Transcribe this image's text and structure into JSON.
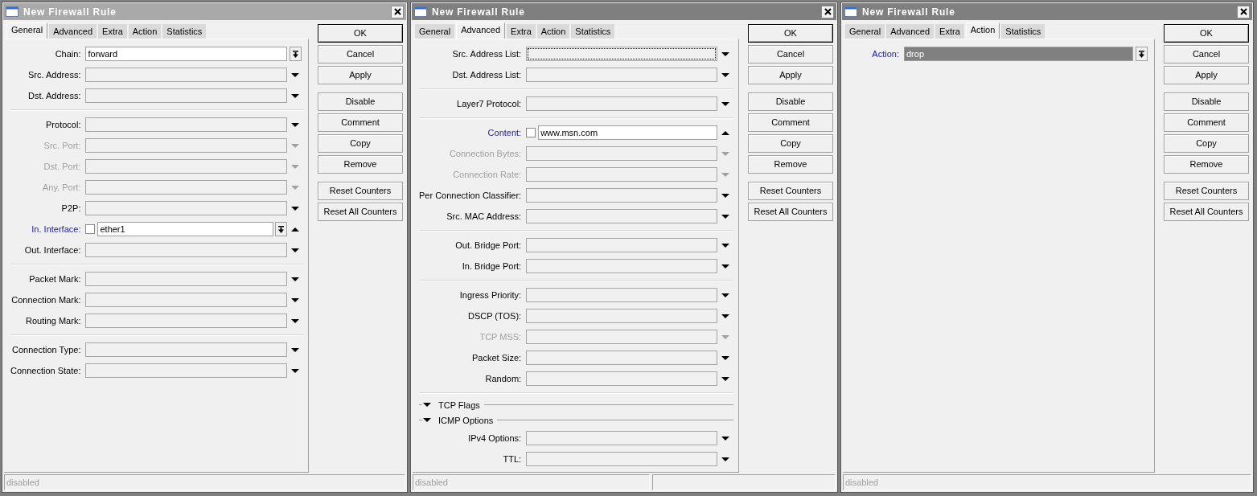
{
  "windows": [
    {
      "title": "New Firewall Rule",
      "active": false,
      "tabs": [
        {
          "label": "General",
          "selected": true
        },
        {
          "label": "Advanced",
          "selected": false
        },
        {
          "label": "Extra",
          "selected": false
        },
        {
          "label": "Action",
          "selected": false
        },
        {
          "label": "Statistics",
          "selected": false
        }
      ],
      "rows": [
        {
          "kind": "fixed",
          "label": "Chain:",
          "emphasized": false,
          "disabled": false,
          "focused": false,
          "value": "forward",
          "dropdown": true,
          "value_selected": false
        },
        {
          "kind": "field",
          "label": "Src. Address:",
          "emphasized": false,
          "disabled": false,
          "focused": false,
          "expanded": false
        },
        {
          "kind": "field",
          "label": "Dst. Address:",
          "emphasized": false,
          "disabled": false,
          "focused": false,
          "expanded": false
        },
        {
          "kind": "separator"
        },
        {
          "kind": "field",
          "label": "Protocol:",
          "emphasized": false,
          "disabled": false,
          "focused": false,
          "expanded": false
        },
        {
          "kind": "field",
          "label": "Src. Port:",
          "emphasized": false,
          "disabled": true,
          "focused": false,
          "expanded": false
        },
        {
          "kind": "field",
          "label": "Dst. Port:",
          "emphasized": false,
          "disabled": true,
          "focused": false,
          "expanded": false
        },
        {
          "kind": "field",
          "label": "Any. Port:",
          "emphasized": false,
          "disabled": true,
          "focused": false,
          "expanded": false
        },
        {
          "kind": "field",
          "label": "P2P:",
          "emphasized": false,
          "disabled": false,
          "focused": false,
          "expanded": false
        },
        {
          "kind": "field",
          "label": "In. Interface:",
          "emphasized": true,
          "disabled": false,
          "focused": false,
          "expanded": true,
          "checked": false,
          "value": "ether1",
          "dropdown": true,
          "value_selected": false
        },
        {
          "kind": "field",
          "label": "Out. Interface:",
          "emphasized": false,
          "disabled": false,
          "focused": false,
          "expanded": false
        },
        {
          "kind": "separator"
        },
        {
          "kind": "field",
          "label": "Packet Mark:",
          "emphasized": false,
          "disabled": false,
          "focused": false,
          "expanded": false
        },
        {
          "kind": "field",
          "label": "Connection Mark:",
          "emphasized": false,
          "disabled": false,
          "focused": false,
          "expanded": false
        },
        {
          "kind": "field",
          "label": "Routing Mark:",
          "emphasized": false,
          "disabled": false,
          "focused": false,
          "expanded": false
        },
        {
          "kind": "separator"
        },
        {
          "kind": "field",
          "label": "Connection Type:",
          "emphasized": false,
          "disabled": false,
          "focused": false,
          "expanded": false
        },
        {
          "kind": "field",
          "label": "Connection State:",
          "emphasized": false,
          "disabled": false,
          "focused": false,
          "expanded": false
        }
      ],
      "button_groups": [
        [
          {
            "label": "OK",
            "default": true
          },
          {
            "label": "Cancel",
            "default": false
          },
          {
            "label": "Apply",
            "default": false
          }
        ],
        [
          {
            "label": "Disable",
            "default": false
          },
          {
            "label": "Comment",
            "default": false
          },
          {
            "label": "Copy",
            "default": false
          },
          {
            "label": "Remove",
            "default": false
          }
        ],
        [
          {
            "label": "Reset Counters",
            "default": false
          },
          {
            "label": "Reset All Counters",
            "default": false
          }
        ]
      ],
      "status_bar": {
        "text": "disabled",
        "extra_panel": false
      }
    },
    {
      "title": "New Firewall Rule",
      "active": true,
      "tabs": [
        {
          "label": "General",
          "selected": false
        },
        {
          "label": "Advanced",
          "selected": true
        },
        {
          "label": "Extra",
          "selected": false
        },
        {
          "label": "Action",
          "selected": false
        },
        {
          "label": "Statistics",
          "selected": false
        }
      ],
      "rows": [
        {
          "kind": "field",
          "label": "Src. Address List:",
          "emphasized": false,
          "disabled": false,
          "focused": true,
          "expanded": false
        },
        {
          "kind": "field",
          "label": "Dst. Address List:",
          "emphasized": false,
          "disabled": false,
          "focused": false,
          "expanded": false
        },
        {
          "kind": "separator"
        },
        {
          "kind": "field",
          "label": "Layer7 Protocol:",
          "emphasized": false,
          "disabled": false,
          "focused": false,
          "expanded": false
        },
        {
          "kind": "separator"
        },
        {
          "kind": "field",
          "label": "Content:",
          "emphasized": true,
          "disabled": false,
          "focused": false,
          "expanded": true,
          "checked": false,
          "value": "www.msn.com",
          "dropdown": false,
          "value_selected": false
        },
        {
          "kind": "field",
          "label": "Connection Bytes:",
          "emphasized": false,
          "disabled": true,
          "focused": false,
          "expanded": false
        },
        {
          "kind": "field",
          "label": "Connection Rate:",
          "emphasized": false,
          "disabled": true,
          "focused": false,
          "expanded": false
        },
        {
          "kind": "field",
          "label": "Per Connection Classifier:",
          "emphasized": false,
          "disabled": false,
          "focused": false,
          "expanded": false
        },
        {
          "kind": "field",
          "label": "Src. MAC Address:",
          "emphasized": false,
          "disabled": false,
          "focused": false,
          "expanded": false
        },
        {
          "kind": "separator"
        },
        {
          "kind": "field",
          "label": "Out. Bridge Port:",
          "emphasized": false,
          "disabled": false,
          "focused": false,
          "expanded": false
        },
        {
          "kind": "field",
          "label": "In. Bridge Port:",
          "emphasized": false,
          "disabled": false,
          "focused": false,
          "expanded": false
        },
        {
          "kind": "separator"
        },
        {
          "kind": "field",
          "label": "Ingress Priority:",
          "emphasized": false,
          "disabled": false,
          "focused": false,
          "expanded": false
        },
        {
          "kind": "field",
          "label": "DSCP (TOS):",
          "emphasized": false,
          "disabled": false,
          "focused": false,
          "expanded": false
        },
        {
          "kind": "field",
          "label": "TCP MSS:",
          "emphasized": false,
          "disabled": true,
          "focused": false,
          "expanded": false
        },
        {
          "kind": "field",
          "label": "Packet Size:",
          "emphasized": false,
          "disabled": false,
          "focused": false,
          "expanded": false
        },
        {
          "kind": "field",
          "label": "Random:",
          "emphasized": false,
          "disabled": false,
          "focused": false,
          "expanded": false
        },
        {
          "kind": "separator"
        },
        {
          "kind": "section",
          "label": "TCP Flags",
          "expanded": false
        },
        {
          "kind": "section",
          "label": "ICMP Options",
          "expanded": false
        },
        {
          "kind": "field",
          "label": "IPv4 Options:",
          "emphasized": false,
          "disabled": false,
          "focused": false,
          "expanded": false
        },
        {
          "kind": "field",
          "label": "TTL:",
          "emphasized": false,
          "disabled": false,
          "focused": false,
          "expanded": false
        }
      ],
      "button_groups": [
        [
          {
            "label": "OK",
            "default": true
          },
          {
            "label": "Cancel",
            "default": false
          },
          {
            "label": "Apply",
            "default": false
          }
        ],
        [
          {
            "label": "Disable",
            "default": false
          },
          {
            "label": "Comment",
            "default": false
          },
          {
            "label": "Copy",
            "default": false
          },
          {
            "label": "Remove",
            "default": false
          }
        ],
        [
          {
            "label": "Reset Counters",
            "default": false
          },
          {
            "label": "Reset All Counters",
            "default": false
          }
        ]
      ],
      "status_bar": {
        "text": "disabled",
        "extra_panel": true
      }
    },
    {
      "title": "New Firewall Rule",
      "active": true,
      "tabs": [
        {
          "label": "General",
          "selected": false
        },
        {
          "label": "Advanced",
          "selected": false
        },
        {
          "label": "Extra",
          "selected": false
        },
        {
          "label": "Action",
          "selected": true
        },
        {
          "label": "Statistics",
          "selected": false
        }
      ],
      "rows": [
        {
          "kind": "fixed",
          "label": "Action:",
          "emphasized": true,
          "disabled": false,
          "focused": false,
          "value": "drop",
          "dropdown": true,
          "value_selected": true
        }
      ],
      "button_groups": [
        [
          {
            "label": "OK",
            "default": true
          },
          {
            "label": "Cancel",
            "default": false
          },
          {
            "label": "Apply",
            "default": false
          }
        ],
        [
          {
            "label": "Disable",
            "default": false
          },
          {
            "label": "Comment",
            "default": false
          },
          {
            "label": "Copy",
            "default": false
          },
          {
            "label": "Remove",
            "default": false
          }
        ],
        [
          {
            "label": "Reset Counters",
            "default": false
          },
          {
            "label": "Reset All Counters",
            "default": false
          }
        ]
      ],
      "status_bar": {
        "text": "disabled",
        "extra_panel": false
      }
    }
  ]
}
